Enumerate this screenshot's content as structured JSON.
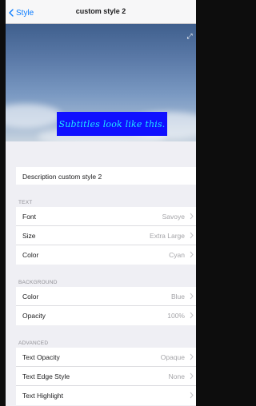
{
  "navbar": {
    "back_label": "Style",
    "title": "custom style 2"
  },
  "preview": {
    "subtitle_text": "Subtitles look like this.",
    "expand_icon": "expand-icon",
    "subtitle_bg_color": "#1010ff",
    "subtitle_text_color": "#20e8ff"
  },
  "description": {
    "label": "Description",
    "value": "custom style 2"
  },
  "sections": {
    "text": {
      "header": "TEXT",
      "rows": [
        {
          "label": "Font",
          "value": "Savoye"
        },
        {
          "label": "Size",
          "value": "Extra Large"
        },
        {
          "label": "Color",
          "value": "Cyan"
        }
      ]
    },
    "background": {
      "header": "BACKGROUND",
      "rows": [
        {
          "label": "Color",
          "value": "Blue"
        },
        {
          "label": "Opacity",
          "value": "100%"
        }
      ]
    },
    "advanced": {
      "header": "ADVANCED",
      "rows": [
        {
          "label": "Text Opacity",
          "value": "Opaque"
        },
        {
          "label": "Text Edge Style",
          "value": "None"
        },
        {
          "label": "Text Highlight",
          "value": ""
        }
      ]
    }
  },
  "colors": {
    "accent": "#0a7cff",
    "value_gray": "#a4a4a8",
    "group_bg": "#efeff4"
  }
}
